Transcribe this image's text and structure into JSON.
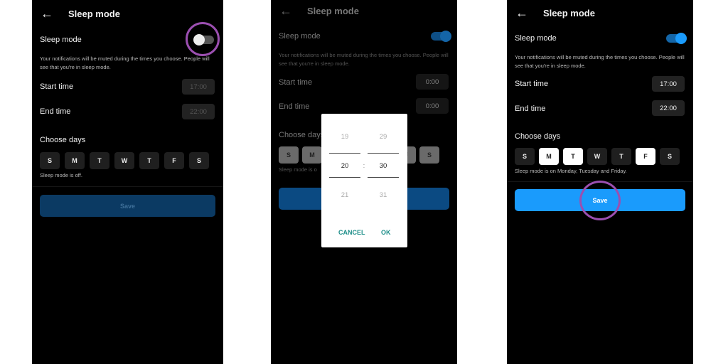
{
  "screens": [
    {
      "title": "Sleep mode",
      "toggle_label": "Sleep mode",
      "toggle_on": false,
      "description": "Your notifications will be muted during the times you choose. People will see that you're in sleep mode.",
      "start_label": "Start time",
      "start_value": "17:00",
      "end_label": "End time",
      "end_value": "22:00",
      "days_label": "Choose days",
      "days": [
        "S",
        "M",
        "T",
        "W",
        "T",
        "F",
        "S"
      ],
      "selected_days": [],
      "status": "Sleep mode is off.",
      "save_label": "Save"
    },
    {
      "title": "Sleep mode",
      "toggle_label": "Sleep mode",
      "toggle_on": true,
      "description": "Your notifications will be muted during the times you choose. People will see that you're in sleep mode.",
      "start_label": "Start time",
      "start_value": "0:00",
      "end_label": "End time",
      "end_value": "0:00",
      "days_label": "Choose days",
      "days": [
        "S",
        "M",
        "T",
        "W",
        "T",
        "F",
        "S"
      ],
      "status": "Sleep mode is o",
      "save_label": "",
      "time_picker": {
        "hour_prev": "19",
        "hour": "20",
        "hour_next": "21",
        "separator": ":",
        "minute_prev": "29",
        "minute": "30",
        "minute_next": "31",
        "cancel_label": "CANCEL",
        "ok_label": "OK"
      }
    },
    {
      "title": "Sleep mode",
      "toggle_label": "Sleep mode",
      "toggle_on": true,
      "description": "Your notifications will be muted during the times you choose. People will see that you're in sleep mode.",
      "start_label": "Start time",
      "start_value": "17:00",
      "end_label": "End time",
      "end_value": "22:00",
      "days_label": "Choose days",
      "days": [
        "S",
        "M",
        "T",
        "W",
        "T",
        "F",
        "S"
      ],
      "selected_days": [
        "M",
        "T",
        "F"
      ],
      "status": "Sleep mode is on Monday, Tuesday and Friday.",
      "save_label": "Save"
    }
  ],
  "colors": {
    "accent": "#1a9bfc",
    "highlight_ring": "#9b4fb0",
    "background": "#000000"
  }
}
